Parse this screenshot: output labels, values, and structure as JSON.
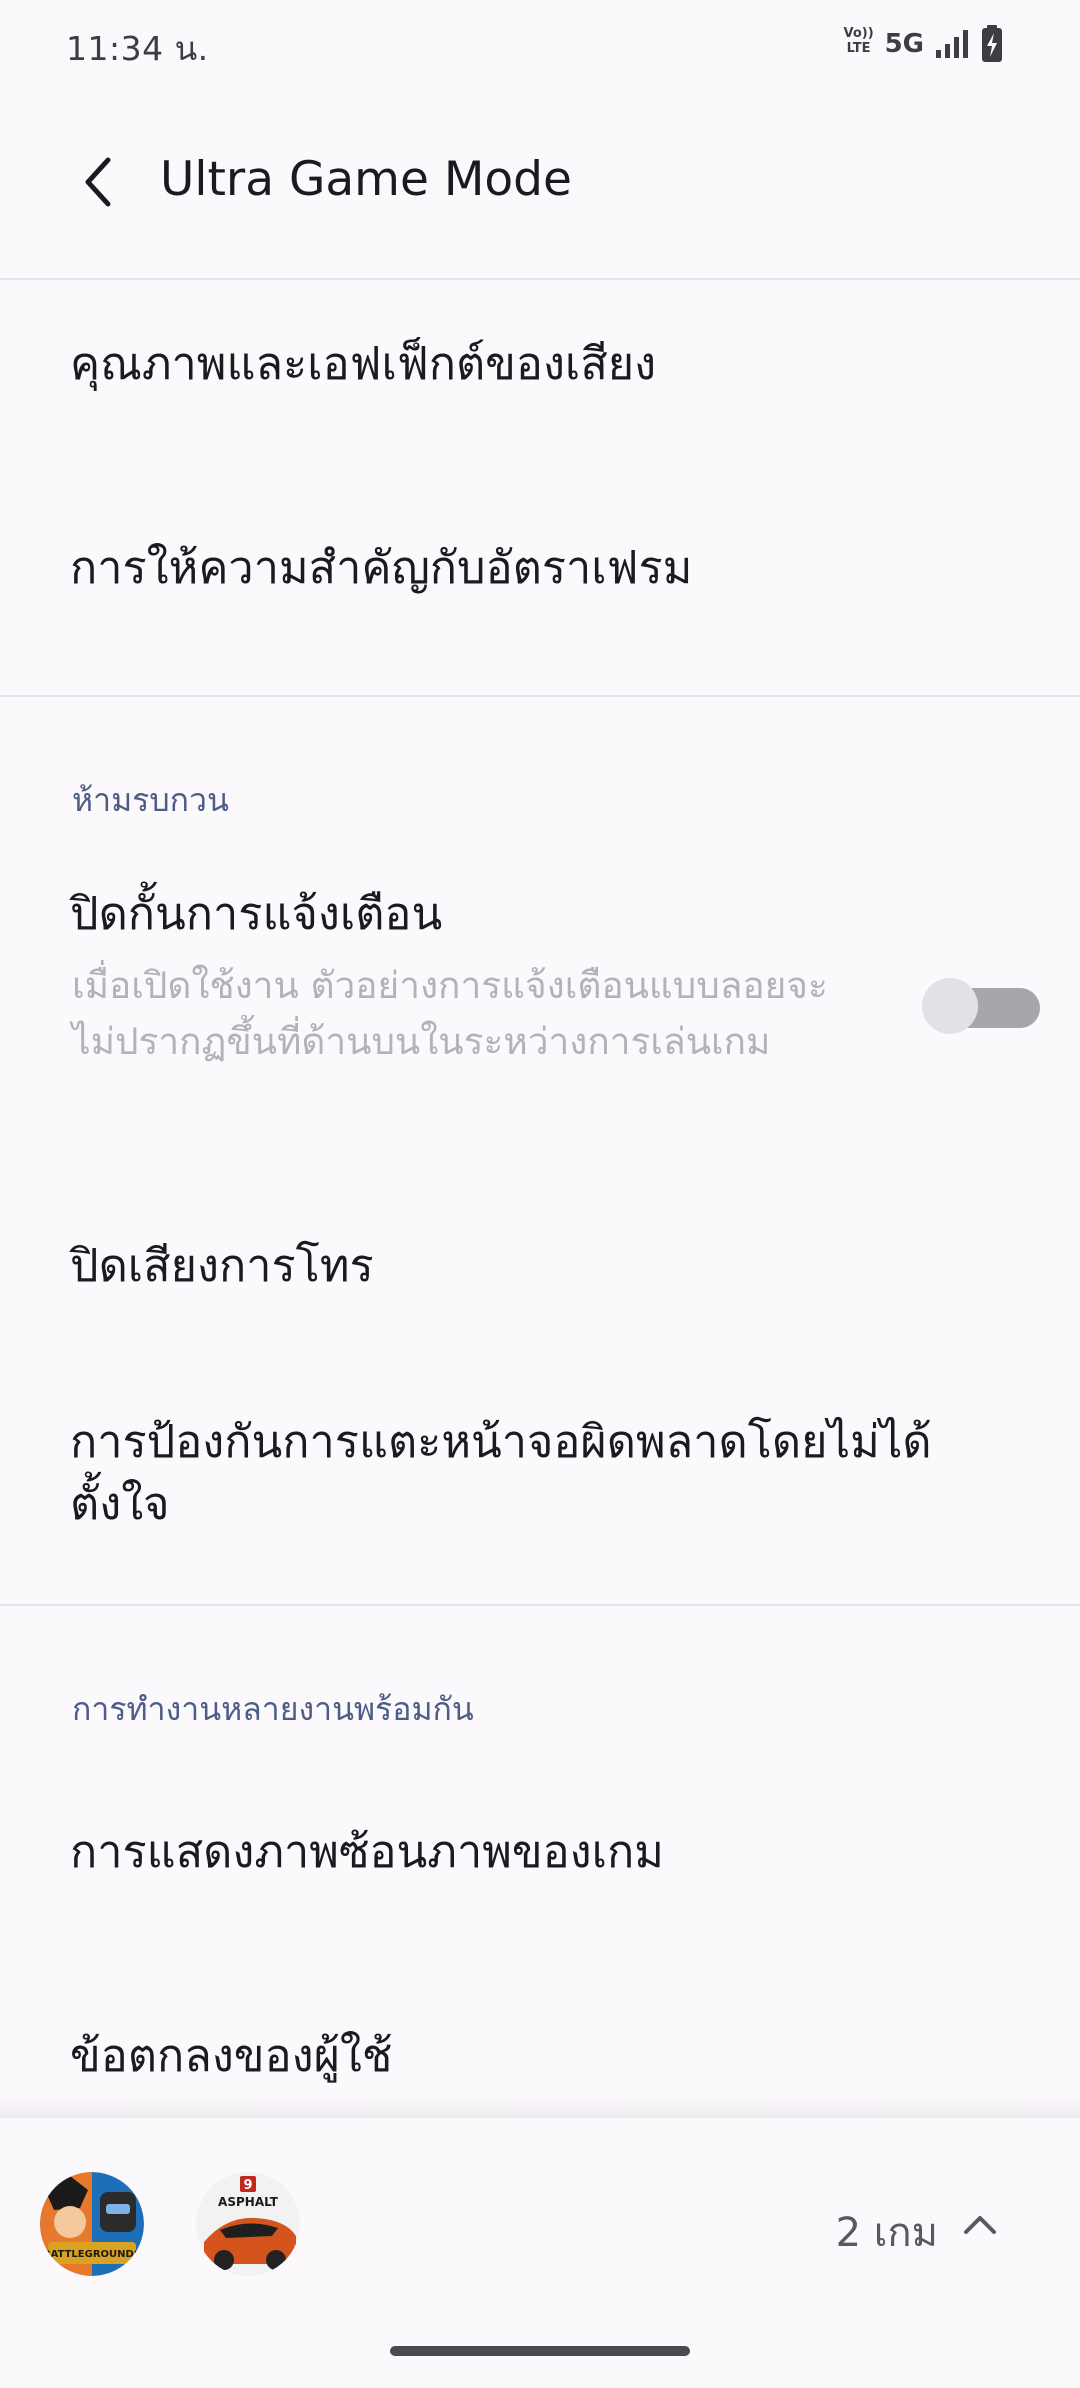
{
  "status_bar": {
    "time": "11:34 น.",
    "volte_top": "Vo))",
    "volte_bottom": "LTE",
    "network": "5G"
  },
  "app_bar": {
    "title": "Ultra Game Mode"
  },
  "items": {
    "sound_quality": "คุณภาพและเอฟเฟ็กต์ของเสียง",
    "frame_rate_priority": "การให้ความสำคัญกับอัตราเฟรม",
    "dnd_header": "ห้ามรบกวน",
    "block_notifications": "ปิดกั้นการแจ้งเตือน",
    "block_notifications_summary": "เมื่อเปิดใช้งาน ตัวอย่างการแจ้งเตือนแบบลอยจะไม่ปรากฏขึ้นที่ด้านบนในระหว่างการเล่นเกม",
    "mute_calls": "ปิดเสียงการโทร",
    "accidental_touch_line1": "การป้องกันการแตะหน้าจอผิดพลาดโดยไม่ได้",
    "accidental_touch_line2": "ตั้งใจ",
    "multitask_header": "การทำงานหลายงานพร้อมกัน",
    "game_overlay": "การแสดงภาพซ้อนภาพของเกม",
    "user_agreement": "ข้อตกลงของผู้ใช้"
  },
  "toggle": {
    "block_notifications_on": false
  },
  "bottom_bar": {
    "games_count": "2 เกม",
    "asphalt_badge": "9",
    "asphalt_label": "ASPHALT",
    "pubg_label": "BATTLEGROUNDS"
  },
  "colors": {
    "background": "#fcf9fd",
    "section_header": "#4d5d86",
    "summary_text": "#b4b2b9",
    "divider": "#e6e3ea"
  }
}
